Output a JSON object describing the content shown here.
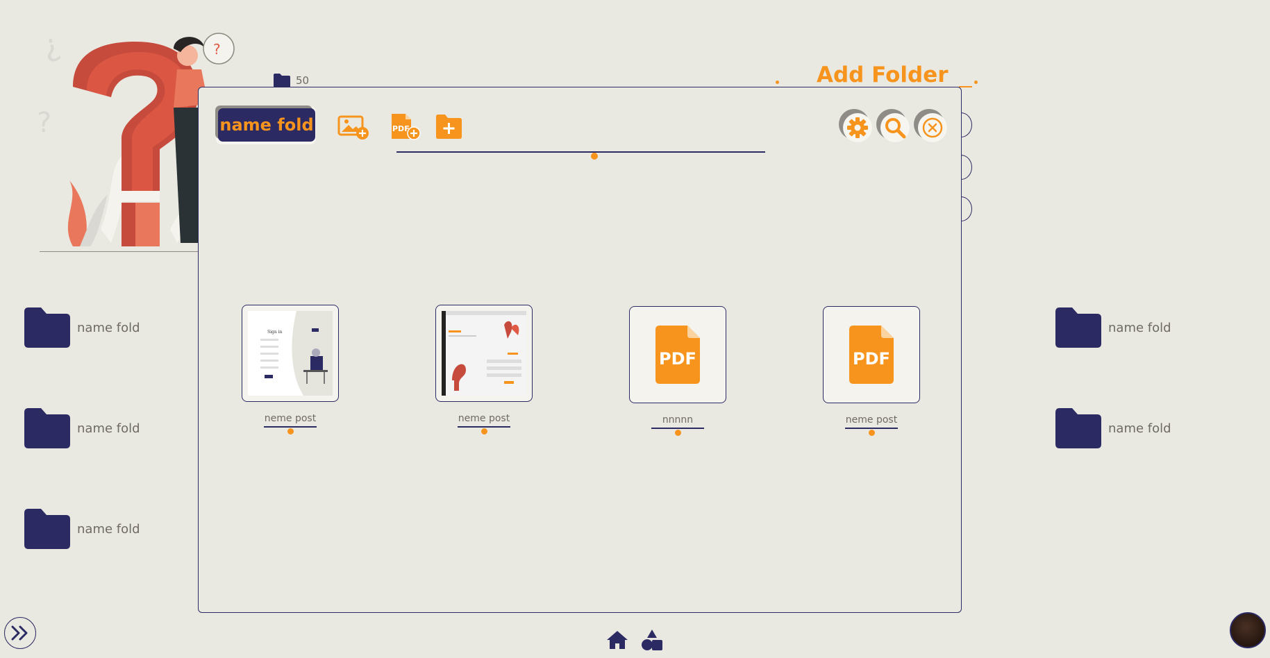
{
  "background": {
    "folder_count": "50",
    "add_folder_title": "Add Folder",
    "left_folders": [
      {
        "label": "name fold"
      },
      {
        "label": "name fold"
      },
      {
        "label": "name fold"
      }
    ],
    "right_folders": [
      {
        "label": "name fold"
      },
      {
        "label": "name fold"
      }
    ]
  },
  "modal": {
    "folder_name": "name fold",
    "toolbar": {
      "icons": [
        "add-image-icon",
        "add-pdf-icon",
        "add-folder-icon"
      ],
      "right_icons": [
        "settings-icon",
        "search-icon",
        "close-icon"
      ]
    },
    "cards": [
      {
        "label": "neme post",
        "type": "image"
      },
      {
        "label": "neme post",
        "type": "image"
      },
      {
        "label": "nnnnn",
        "type": "pdf",
        "badge": "PDF"
      },
      {
        "label": "neme post",
        "type": "pdf",
        "badge": "PDF"
      }
    ]
  },
  "bottom_nav": {
    "icons": [
      "home-icon",
      "shapes-icon"
    ]
  },
  "colors": {
    "accent": "#f7941d",
    "primary": "#2c2a63",
    "background": "#e9e9e1",
    "text": "#6f6a62"
  }
}
